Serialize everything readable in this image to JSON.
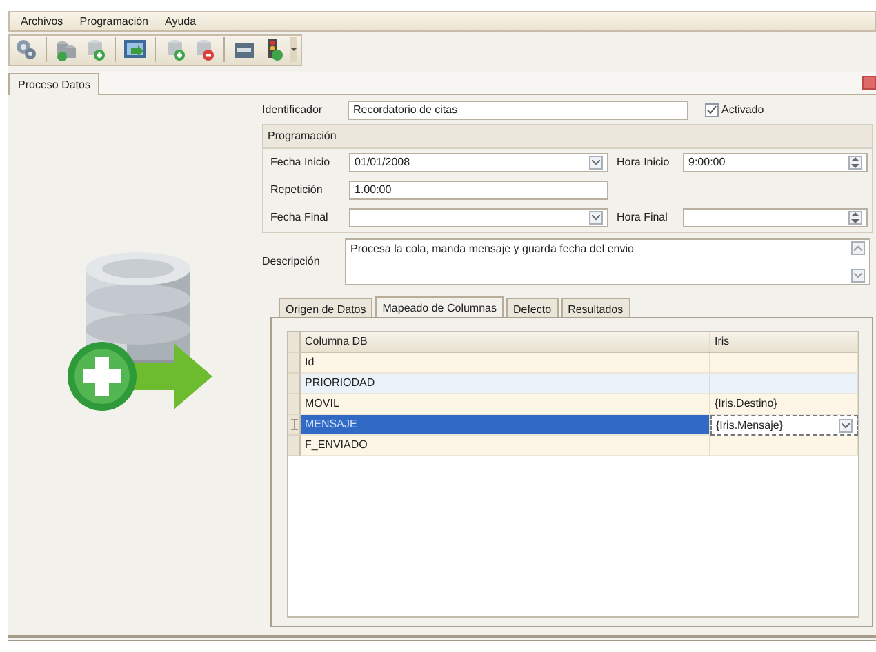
{
  "menu": [
    "Archivos",
    "Programación",
    "Ayuda"
  ],
  "document_tabs": [
    {
      "label": "Proceso Datos",
      "selected": true
    }
  ],
  "form": {
    "identificador": {
      "label": "Identificador",
      "value": "Recordatorio de citas"
    },
    "activado": {
      "label": "Activado",
      "checked": true
    },
    "programacion": {
      "title": "Programación",
      "fecha_inicio": {
        "label": "Fecha Inicio",
        "value": "01/01/2008"
      },
      "hora_inicio": {
        "label": "Hora Inicio",
        "value": "9:00:00"
      },
      "repeticion": {
        "label": "Repetición",
        "value": "1.00:00"
      },
      "fecha_final": {
        "label": "Fecha Final"
      },
      "hora_final": {
        "label": "Hora Final"
      }
    },
    "descripcion": {
      "label": "Descripción",
      "value": "Procesa la cola, manda mensaje y guarda fecha del envio"
    }
  },
  "tabs": [
    {
      "label": "Origen de Datos",
      "selected": false
    },
    {
      "label": "Mapeado de Columnas",
      "selected": true
    },
    {
      "label": "Defecto",
      "selected": false
    },
    {
      "label": "Resultados",
      "selected": false
    }
  ],
  "table": {
    "columns": [
      "Columna DB",
      "Iris"
    ],
    "rows": [
      {
        "cells": [
          "Id",
          ""
        ],
        "selected": false
      },
      {
        "cells": [
          "PRIORIODAD",
          ""
        ],
        "selected": false
      },
      {
        "cells": [
          "MOVIL",
          "{Iris.Destino}"
        ],
        "selected": false
      },
      {
        "cells": [
          "MENSAJE",
          "{Iris.Mensaje}"
        ],
        "selected": true
      },
      {
        "cells": [
          "F_ENVIADO",
          ""
        ],
        "selected": false
      }
    ]
  }
}
